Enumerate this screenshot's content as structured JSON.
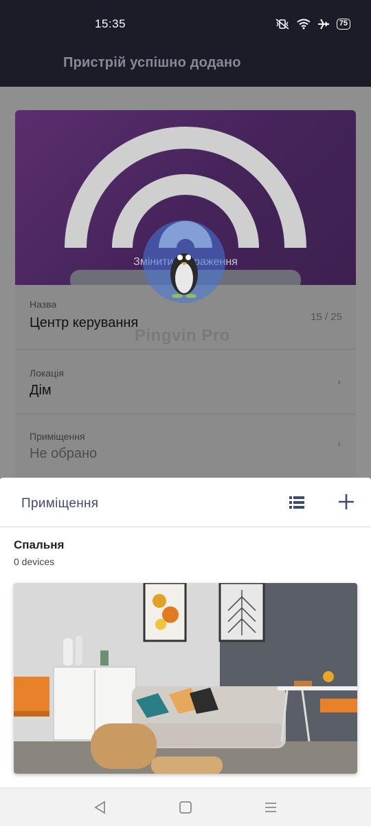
{
  "status_bar": {
    "time": "15:35",
    "battery": "75",
    "icons": [
      "vibrate-off-icon",
      "wifi-icon",
      "airplane-icon",
      "battery-icon"
    ]
  },
  "app_bar": {
    "title": "Пристрій успішно додано"
  },
  "device_card": {
    "change_image_label": "Змінити зображення",
    "name_field": {
      "label": "Назва",
      "value": "Центр керування",
      "counter": "15 / 25"
    },
    "location_field": {
      "label": "Локація",
      "value": "Дім"
    },
    "room_field": {
      "label": "Приміщення",
      "value": "Не обрано"
    }
  },
  "watermark": {
    "text": "Pingvin Pro"
  },
  "room_sheet": {
    "title": "Приміщення",
    "list_icon": "list-view-icon",
    "add_icon": "plus-icon",
    "rooms": [
      {
        "name": "Спальня",
        "subtitle": "0 devices"
      }
    ]
  },
  "nav_bar": {
    "buttons": [
      "back-icon",
      "home-icon",
      "recents-icon"
    ]
  },
  "colors": {
    "status_bg": "#1c1b28",
    "hero_purple": "#4a2760",
    "accent_navy": "#3f4a6e"
  }
}
